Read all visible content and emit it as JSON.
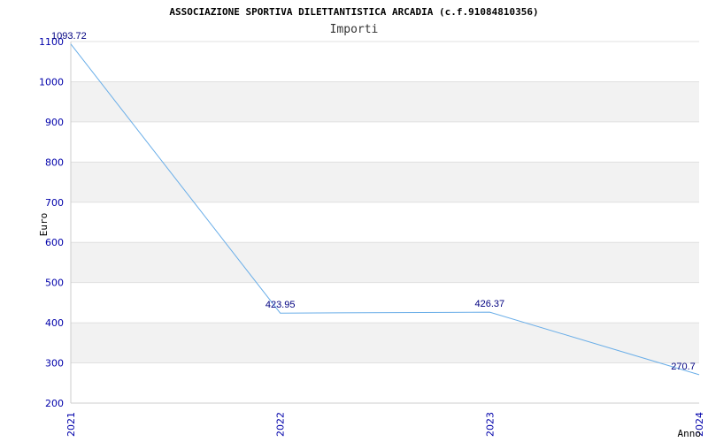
{
  "chart_data": {
    "type": "line",
    "title": "ASSOCIAZIONE SPORTIVA DILETTANTISTICA ARCADIA (c.f.91084810356)",
    "subtitle": "Importi",
    "xlabel": "Anno",
    "ylabel": "Euro",
    "categories": [
      "2021",
      "2022",
      "2023",
      "2024"
    ],
    "series": [
      {
        "values": [
          1093.72,
          423.95,
          426.37,
          270.7
        ],
        "labels": [
          "1093.72",
          "423.95",
          "426.37",
          "270.7"
        ]
      }
    ],
    "ylim": [
      200,
      1100
    ],
    "yticks": [
      200,
      300,
      400,
      500,
      600,
      700,
      800,
      900,
      1000,
      1100
    ],
    "grid": true,
    "line_color": "#6aaee8",
    "tick_color": "#0000aa",
    "band_color": "#f2f2f2"
  }
}
